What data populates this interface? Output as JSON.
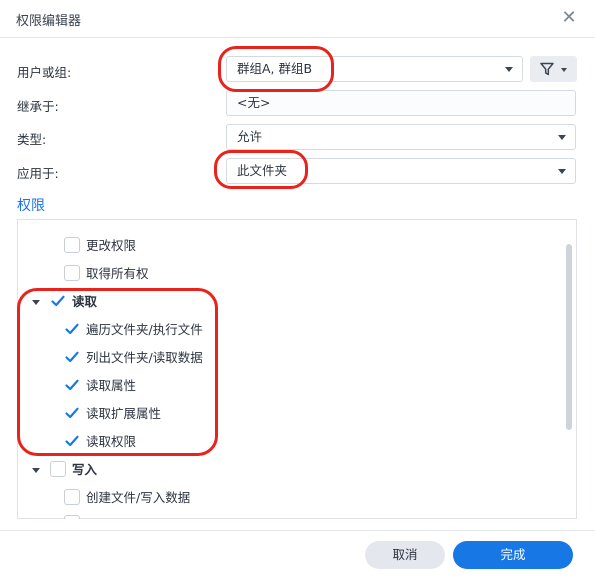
{
  "dialog": {
    "title": "权限编辑器"
  },
  "form": {
    "user_or_group": {
      "label": "用户或组:",
      "value": "群组A, 群组B"
    },
    "inherit_from": {
      "label": "继承于:",
      "value": "<无>"
    },
    "type": {
      "label": "类型:",
      "value": "允许"
    },
    "apply_to": {
      "label": "应用于:",
      "value": "此文件夹"
    }
  },
  "permissions": {
    "section_title": "权限",
    "items": [
      {
        "label": "更改权限",
        "checked": false
      },
      {
        "label": "取得所有权",
        "checked": false
      },
      {
        "label": "读取",
        "checked": true,
        "group": true,
        "expanded": true
      },
      {
        "label": "遍历文件夹/执行文件",
        "checked": true
      },
      {
        "label": "列出文件夹/读取数据",
        "checked": true
      },
      {
        "label": "读取属性",
        "checked": true
      },
      {
        "label": "读取扩展属性",
        "checked": true
      },
      {
        "label": "读取权限",
        "checked": true
      },
      {
        "label": "写入",
        "checked": false,
        "group": true,
        "expanded": true
      },
      {
        "label": "创建文件/写入数据",
        "checked": false
      }
    ]
  },
  "footer": {
    "cancel_label": "取消",
    "done_label": "完成"
  },
  "colors": {
    "accent": "#1677e5",
    "annotation": "#e8231c"
  },
  "icons": {
    "close": "close-icon",
    "filter": "filter-icon",
    "check": "check-icon"
  }
}
